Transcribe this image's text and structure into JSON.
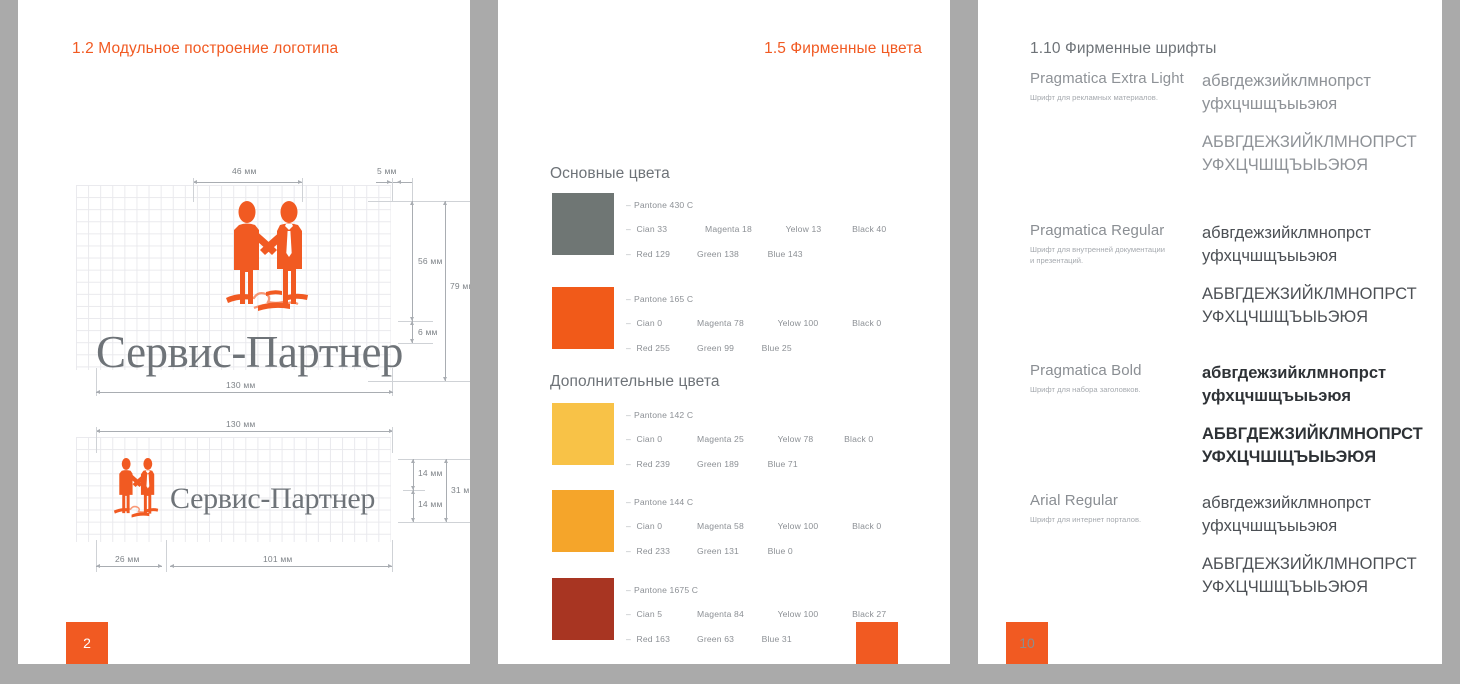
{
  "deck": {
    "background_color": "#aaaaaa",
    "accent_color": "#f15a22",
    "page_count": 3
  },
  "page1": {
    "title": "1.2 Модульное построение логотипа",
    "badge": "2",
    "logo_wordmark": "Сервис-Партнер",
    "logo_mark_name": "two-people-handshake-puzzle-logo",
    "dimensions": {
      "mark_width": "46 мм",
      "gap_right": "5 мм",
      "mark_height": "56 мм",
      "total_height": "79 мм",
      "gap_between": "6 мм",
      "total_width_top": "130 мм",
      "total_width_bottom": "130 мм",
      "mark_height_small_top": "14 мм",
      "mark_height_small_bottom": "14 мм",
      "total_height_small": "31 мм",
      "mark_width_small": "26 мм",
      "wordmark_width_small": "101 мм"
    }
  },
  "page2": {
    "title": "1.5 Фирменные цвета",
    "badge": "",
    "groups": [
      {
        "name": "Основные цвета",
        "colors": [
          {
            "hex": "#6f7674",
            "pantone": "Pantone 430 C",
            "cmyk": [
              "Cian 33",
              "Magenta 18",
              "Yelow 13",
              "Black 40"
            ],
            "rgb": [
              "Red 129",
              "Green 138",
              "Blue 143"
            ]
          },
          {
            "hex": "#f15a19",
            "pantone": "Pantone 165 C",
            "cmyk": [
              "Cian 0",
              "Magenta 78",
              "Yelow 100",
              "Black 0"
            ],
            "rgb": [
              "Red 255",
              "Green 99",
              "Blue 25"
            ]
          }
        ]
      },
      {
        "name": "Дополнительные цвета",
        "colors": [
          {
            "hex": "#f8c247",
            "pantone": "Pantone 142 C",
            "cmyk": [
              "Cian 0",
              "Magenta 25",
              "Yelow 78",
              "Black 0"
            ],
            "rgb": [
              "Red 239",
              "Green 189",
              "Blue 71"
            ]
          },
          {
            "hex": "#f5a52a",
            "pantone": "Pantone 144 C",
            "cmyk": [
              "Cian 0",
              "Magenta 58",
              "Yelow 100",
              "Black 0"
            ],
            "rgb": [
              "Red 233",
              "Green 131",
              "Blue 0"
            ]
          },
          {
            "hex": "#a83522",
            "pantone": "Pantone 1675 C",
            "cmyk": [
              "Cian 5",
              "Magenta 84",
              "Yelow 100",
              "Black 27"
            ],
            "rgb": [
              "Red 163",
              "Green 63",
              "Blue 31"
            ]
          }
        ]
      }
    ]
  },
  "page3": {
    "title": "1.10 Фирменные шрифты",
    "badge": "10",
    "fonts": [
      {
        "name": "Pragmatica Extra Light",
        "note": "Шрифт для рекламных материалов.",
        "lower_line1": "абвгдежзийклмнопрст",
        "lower_line2": "уфхцчшщъыьэюя",
        "upper_line1": "АБВГДЕЖЗИЙКЛМНОПРСТ",
        "upper_line2": "УФХЦЧШЩЪЫЬЭЮЯ",
        "weight": "light"
      },
      {
        "name": "Pragmatica Regular",
        "note": "Шрифт для внутренней документации и презентаций.",
        "lower_line1": "абвгдежзийклмнопрст",
        "lower_line2": "уфхцчшщъыьэюя",
        "upper_line1": "АБВГДЕЖЗИЙКЛМНОПРСТ",
        "upper_line2": "УФХЦЧШЩЪЫЬЭЮЯ",
        "weight": "regular"
      },
      {
        "name": "Pragmatica Bold",
        "note": "Шрифт для набора заголовков.",
        "lower_line1": "абвгдежзийклмнопрст",
        "lower_line2": "уфхцчшщъыьэюя",
        "upper_line1": "АБВГДЕЖЗИЙКЛМНОПРСТ",
        "upper_line2": "УФХЦЧШЩЪЫЬЭЮЯ",
        "weight": "bold"
      },
      {
        "name": "Arial Regular",
        "note": "Шрифт для интернет порталов.",
        "lower_line1": "абвгдежзийклмнопрст",
        "lower_line2": "уфхцчшщъыьэюя",
        "upper_line1": "АБВГДЕЖЗИЙКЛМНОПРСТ",
        "upper_line2": "УФХЦЧШЩЪЫЬЭЮЯ",
        "weight": "regular"
      }
    ]
  }
}
